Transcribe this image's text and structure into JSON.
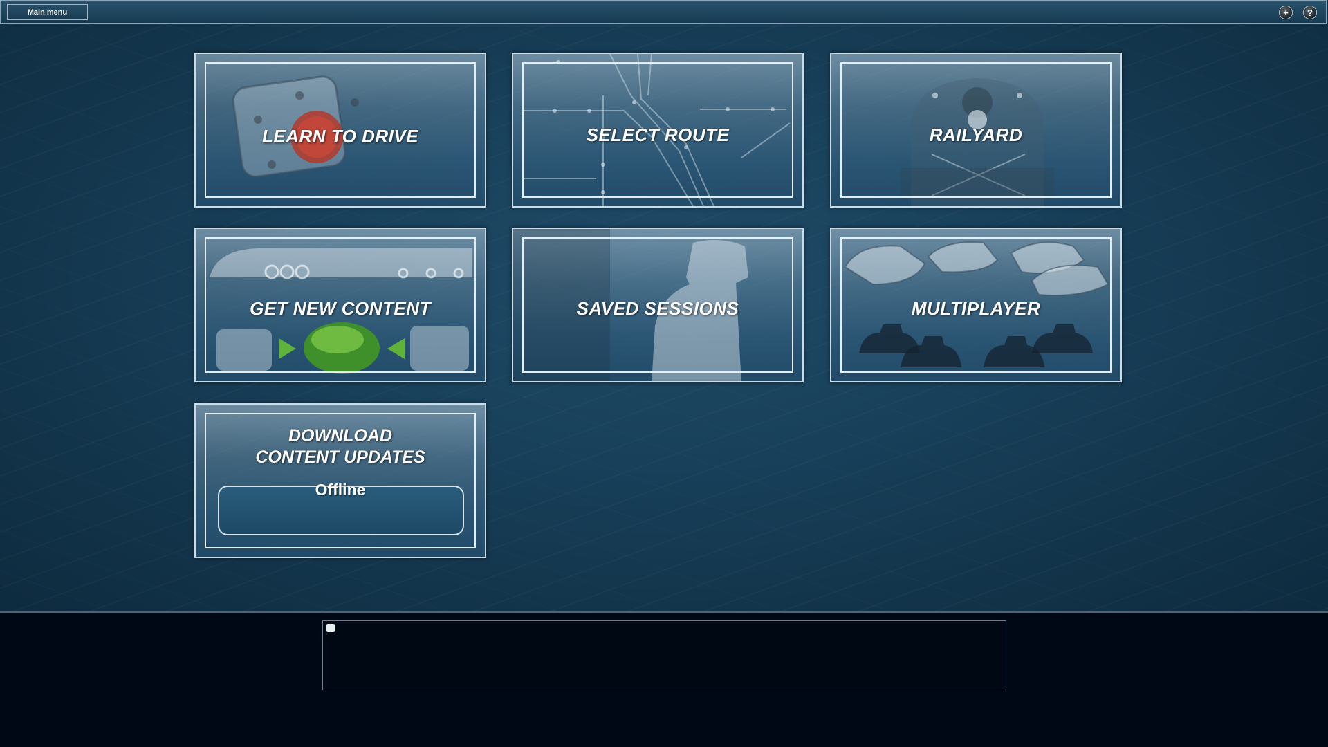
{
  "top_bar": {
    "main_menu_label": "Main menu",
    "add_icon": "+",
    "help_icon": "?"
  },
  "tiles": {
    "learn_to_drive": "LEARN TO DRIVE",
    "select_route": "SELECT ROUTE",
    "railyard": "RAILYARD",
    "get_new_content": "GET NEW CONTENT",
    "saved_sessions": "SAVED SESSIONS",
    "multiplayer": "MULTIPLAYER",
    "download_line1": "DOWNLOAD",
    "download_line2": "CONTENT UPDATES",
    "download_status": "Offline"
  },
  "colors": {
    "background": "#18405a",
    "tile_border": "#c9dbe6",
    "footer": "#000816"
  }
}
